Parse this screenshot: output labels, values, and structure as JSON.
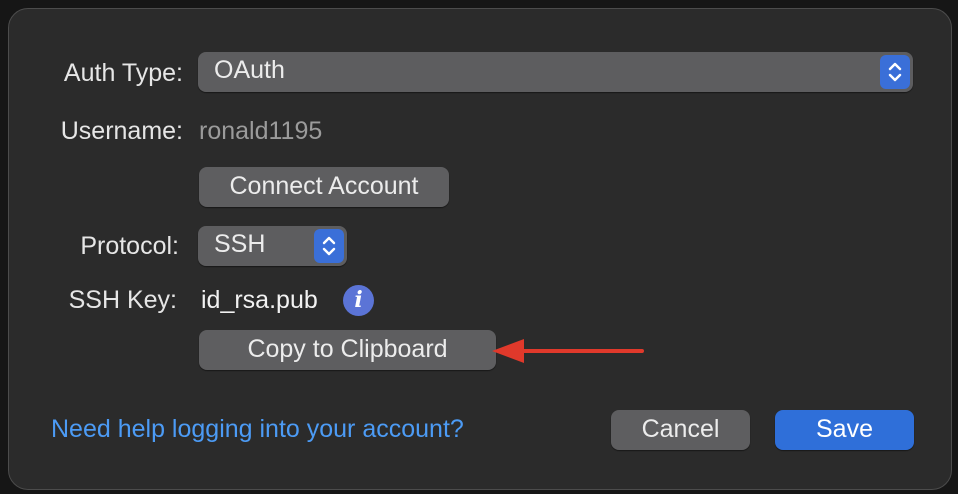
{
  "auth_type": {
    "label": "Auth Type:",
    "value": "OAuth"
  },
  "username": {
    "label": "Username:",
    "value": "ronald1195"
  },
  "connect_account_label": "Connect Account",
  "protocol": {
    "label": "Protocol:",
    "value": "SSH"
  },
  "ssh_key": {
    "label": "SSH Key:",
    "value": "id_rsa.pub",
    "info_icon": "info-icon",
    "info_glyph": "i"
  },
  "copy_to_clipboard_label": "Copy to Clipboard",
  "help_link": "Need help logging into your account?",
  "cancel_label": "Cancel",
  "save_label": "Save",
  "annotation": {
    "icon": "arrow-left-icon",
    "color": "#e0392b"
  },
  "colors": {
    "accent": "#2f6fd9",
    "link": "#4c9bf5",
    "panel": "#2b2b2b"
  }
}
